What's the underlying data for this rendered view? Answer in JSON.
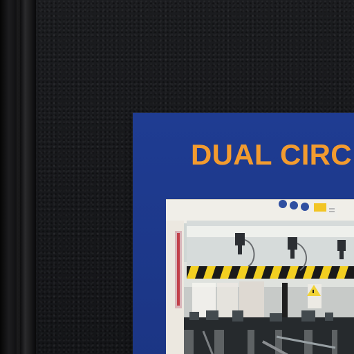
{
  "poster": {
    "title": "DUAL CIRC"
  },
  "colors": {
    "poster_blue": "#1f3c92",
    "title_orange": "#f29b2f",
    "wall": "#18191c"
  },
  "photo": {
    "subject": "industrial-press-machine",
    "icons": [
      "safety-icon",
      "safety-icon",
      "safety-icon",
      "warning-label"
    ]
  }
}
